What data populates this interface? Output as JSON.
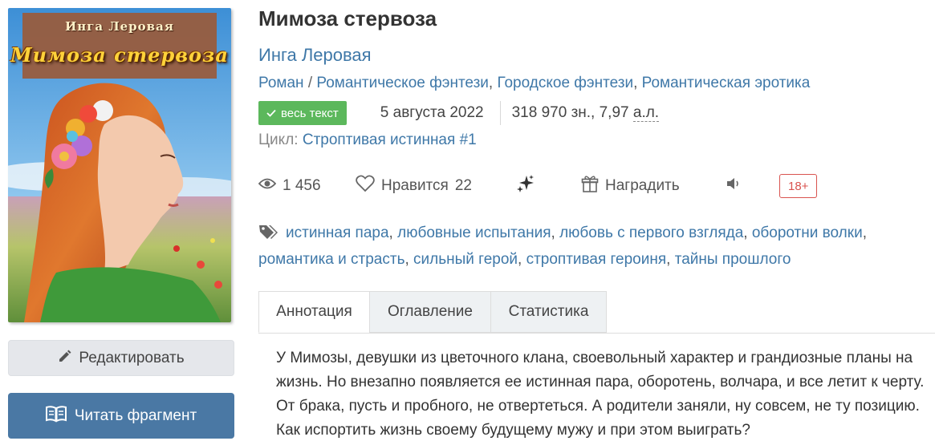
{
  "cover": {
    "author_text": "Инга Леровая",
    "title_text": "Мимоза стервоза"
  },
  "buttons": {
    "edit_label": "Редактировать",
    "read_label": "Читать фрагмент"
  },
  "book": {
    "title": "Мимоза стервоза",
    "author": "Инга Леровая",
    "genre_main": "Роман",
    "genre_separator": "/",
    "subgenres": [
      "Романтическое фэнтези",
      "Городское фэнтези",
      "Романтическая эротика"
    ],
    "status_badge": "весь текст",
    "date": "5 августа 2022",
    "size_chars": "318 970 зн., 7,97",
    "size_unit": "а.л.",
    "cycle_label": "Цикл:",
    "cycle_name": "Строптивая истинная #1"
  },
  "stats": {
    "views": "1 456",
    "like_label": "Нравится",
    "likes": "22",
    "award_label": "Наградить",
    "age_rating": "18+"
  },
  "tags": [
    "истинная пара",
    "любовные испытания",
    "любовь с первого взгляда",
    "оборотни волки",
    "романтика и страсть",
    "сильный герой",
    "строптивая героиня",
    "тайны прошлого"
  ],
  "tabs": [
    "Аннотация",
    "Оглавление",
    "Статистика"
  ],
  "active_tab": "Аннотация",
  "annotation": "У Мимозы, девушки из цветочного клана, своевольный характер и грандиозные планы на жизнь. Но внезапно появляется ее истинная пара, оборотень, волчара, и все летит к черту. От брака, пусть и пробного, не отвертеться. А родители заняли, ну совсем, не ту позицию. Как испортить жизнь своему будущему мужу и при этом выиграть?",
  "colors": {
    "link": "#3f78a8",
    "badge_green": "#5cb85c",
    "read_button": "#4a78a4",
    "age_badge": "#d9534f"
  }
}
